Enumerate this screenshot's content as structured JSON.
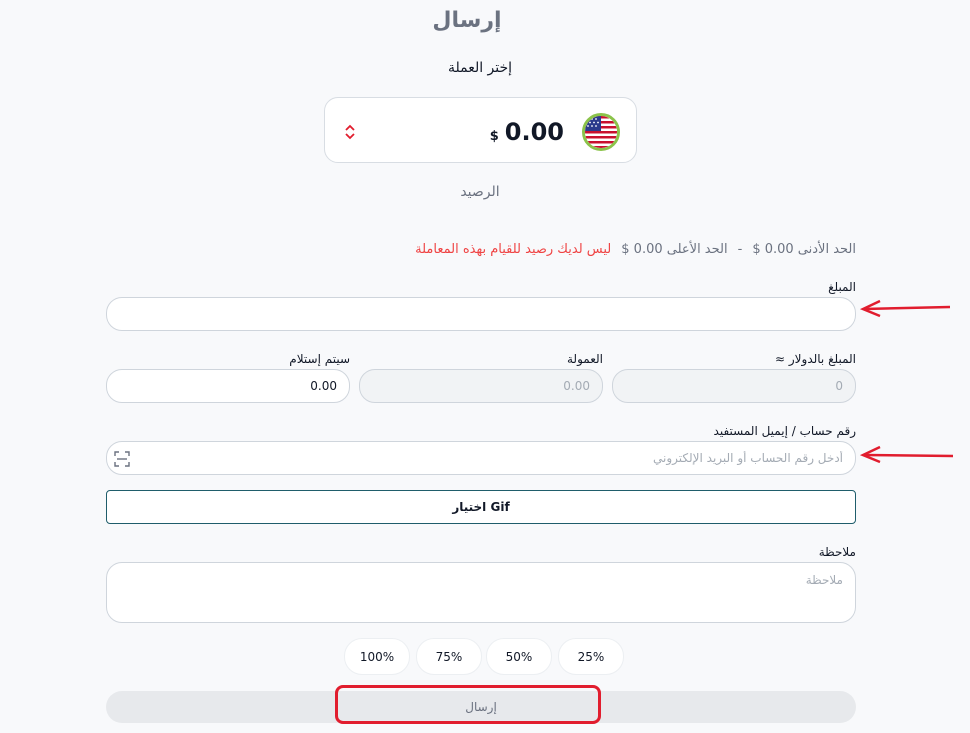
{
  "page": {
    "title": "إرسال"
  },
  "currency": {
    "label": "إختر العملة",
    "amount": "0.00",
    "symbol": "$",
    "balance_label": "الرصيد",
    "flag_icon": "us-flag-icon"
  },
  "limits": {
    "min": "الحد الأدنى 0.00 $",
    "separator": "-",
    "max": "الحد الأعلى 0.00 $",
    "error": "ليس لديك رصيد للقيام بهذه المعاملة"
  },
  "amount_field": {
    "label": "المبلغ",
    "value": ""
  },
  "usd_amount_field": {
    "label": "المبلغ بالدولار ≈",
    "placeholder": "0"
  },
  "commission_field": {
    "label": "العمولة",
    "placeholder": "0.00"
  },
  "receive_field": {
    "label": "سيتم إستلام",
    "value": "0.00"
  },
  "recipient_field": {
    "label": "رقم حساب / إيميل المستفيد",
    "placeholder": "أدخل رقم الحساب أو البريد الإلكتروني",
    "scan_icon": "scan-icon"
  },
  "gif_button": {
    "label": "اختيار Gif"
  },
  "note_field": {
    "label": "ملاحظة",
    "placeholder": "ملاحظة"
  },
  "percent_buttons": [
    "25%",
    "50%",
    "75%",
    "100%"
  ],
  "submit_button": {
    "label": "إرسال"
  },
  "colors": {
    "error": "#ef4444",
    "annotation": "#e11d2e",
    "gif_border": "#1f5d6b"
  }
}
